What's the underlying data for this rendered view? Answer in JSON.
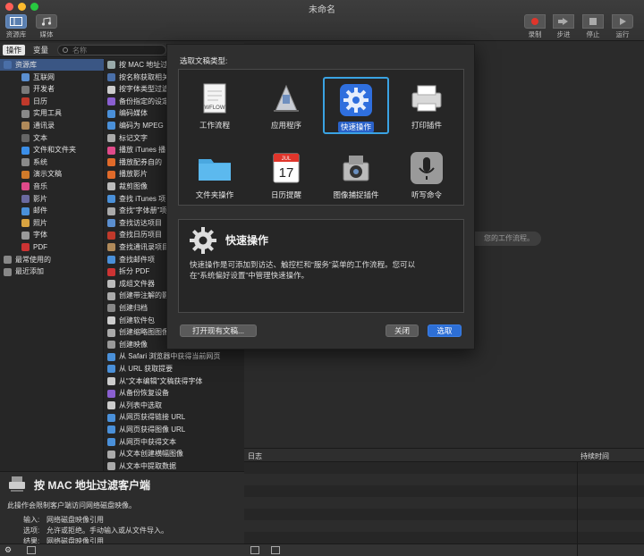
{
  "window": {
    "title": "未命名"
  },
  "toolbar": {
    "left": [
      {
        "label": "资源库"
      },
      {
        "label": "媒体"
      }
    ],
    "right": [
      {
        "label": "录制"
      },
      {
        "label": "步进"
      },
      {
        "label": "停止"
      },
      {
        "label": "运行"
      }
    ]
  },
  "tabs": {
    "actions": "操作",
    "variables": "变量",
    "search_placeholder": "名称"
  },
  "library": [
    "资源库",
    "互联网",
    "开发者",
    "日历",
    "实用工具",
    "通讯录",
    "文本",
    "文件和文件夹",
    "系统",
    "演示文稿",
    "音乐",
    "影片",
    "邮件",
    "照片",
    "字体",
    "PDF",
    "最常使用的",
    "最近添加"
  ],
  "actions": [
    "按 MAC 地址过滤",
    "按名称获取相关",
    "按字体类型过滤",
    "备份指定的设定",
    "编码媒体",
    "编码为 MPEG",
    "标记文字",
    "播放 iTunes 播",
    "播放配券自的",
    "播放影片",
    "裁剪图像",
    "查找 iTunes 项",
    "查找“字体册”项",
    "查找访达项目",
    "查找日历项目",
    "查找通讯录项目",
    "查找邮件项",
    "拆分 PDF",
    "成组文件器",
    "创建带注解的影",
    "创建归档",
    "创建软件包",
    "创建缩略图图像",
    "创建映像",
    "从 Safari 浏览器中获得当前网页",
    "从 URL 获取提要",
    "从“文本编辑”文稿获得字体",
    "从备份恢复设备",
    "从列表中选取",
    "从网页获得链接 URL",
    "从网页获得图像 URL",
    "从网页中获得文本",
    "从文本创建横幅图像",
    "从文本中提取数据"
  ],
  "description": {
    "title": "按 MAC 地址过滤客户端",
    "summary": "此操作会限制客户端访问网络磁盘映像。",
    "input_label": "输入:",
    "input_value": "网络磁盘映像引用",
    "options_label": "选项:",
    "options_value": "允许或拒绝。手动输入或从文件导入。",
    "result_label": "结果:",
    "result_value": "网络磁盘映像引用"
  },
  "workspace": {
    "hint": "您的工作流程。"
  },
  "log": {
    "col_log": "日志",
    "col_duration": "持续时间"
  },
  "dialog": {
    "heading": "选取文稿类型:",
    "types": [
      {
        "label": "工作流程"
      },
      {
        "label": "应用程序"
      },
      {
        "label": "快速操作"
      },
      {
        "label": "打印插件"
      },
      {
        "label": "文件夹操作"
      },
      {
        "label": "日历提醒"
      },
      {
        "label": "图像捕捉插件"
      },
      {
        "label": "听写命令"
      }
    ],
    "selected_index": 2,
    "calendar": {
      "month": "JUL",
      "day": "17"
    },
    "workflow_tag": "WFLOW",
    "info_title": "快速操作",
    "info_line1": "快速操作是可添加到访达、触控栏和“服务”菜单的工作流程。您可以",
    "info_line2": "在“系统偏好设置”中管理快速操作。",
    "open_existing": "打开现有文稿...",
    "close": "关闭",
    "choose": "选取"
  },
  "colors": {
    "accent": "#2d6fd6",
    "selection": "#3aa3e3"
  }
}
